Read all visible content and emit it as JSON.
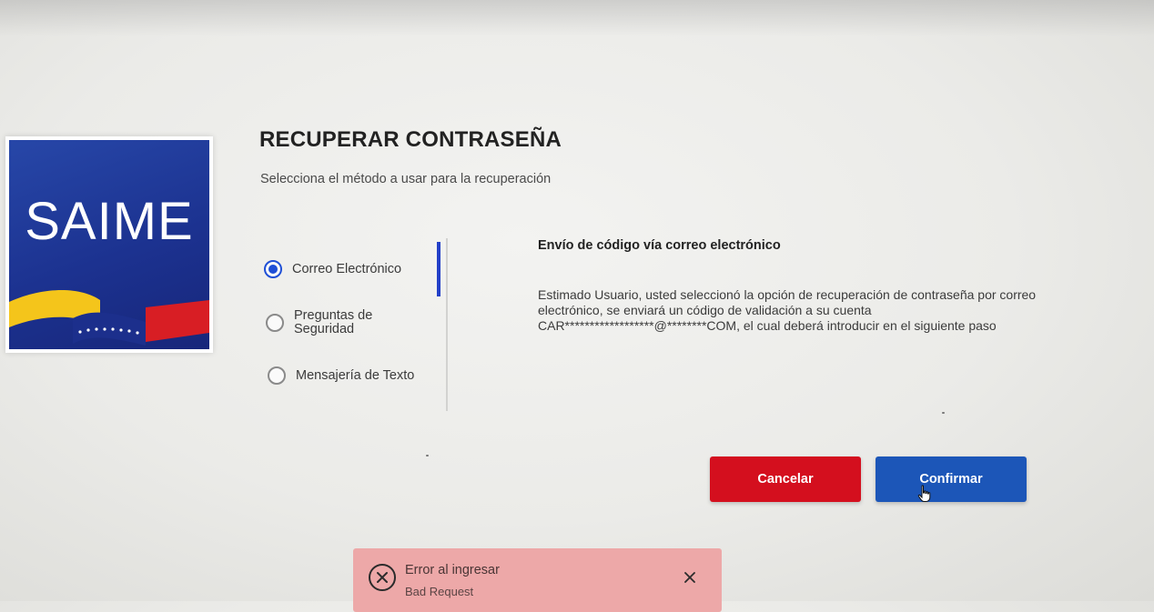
{
  "logo": {
    "text": "SAIME"
  },
  "header": {
    "title": "RECUPERAR CONTRASEÑA",
    "subtitle": "Selecciona el método a usar para la recuperación"
  },
  "methods": [
    {
      "label": "Correo Electrónico",
      "selected": true
    },
    {
      "label": "Preguntas de Seguridad",
      "selected": false
    },
    {
      "label": "Mensajería de Texto",
      "selected": false
    }
  ],
  "panel": {
    "title": "Envío de código vía correo electrónico",
    "body": "Estimado Usuario, usted seleccionó la opción de recuperación de contraseña por correo electrónico, se enviará un código de validación a su cuenta CAR******************@********COM, el cual deberá introducir en el siguiente paso"
  },
  "buttons": {
    "cancel_label": "Cancelar",
    "confirm_label": "Confirmar"
  },
  "toast": {
    "title": "Error al ingresar",
    "message": "Bad Request"
  },
  "colors": {
    "primary_blue": "#1c56b8",
    "danger_red": "#d40f1e",
    "radio_blue": "#1f4fd6",
    "toast_background": "#eda8a8"
  },
  "icons": {
    "toast": "error-circle-x-icon",
    "close": "close-x-icon",
    "cursor": "hand-pointer-icon"
  }
}
